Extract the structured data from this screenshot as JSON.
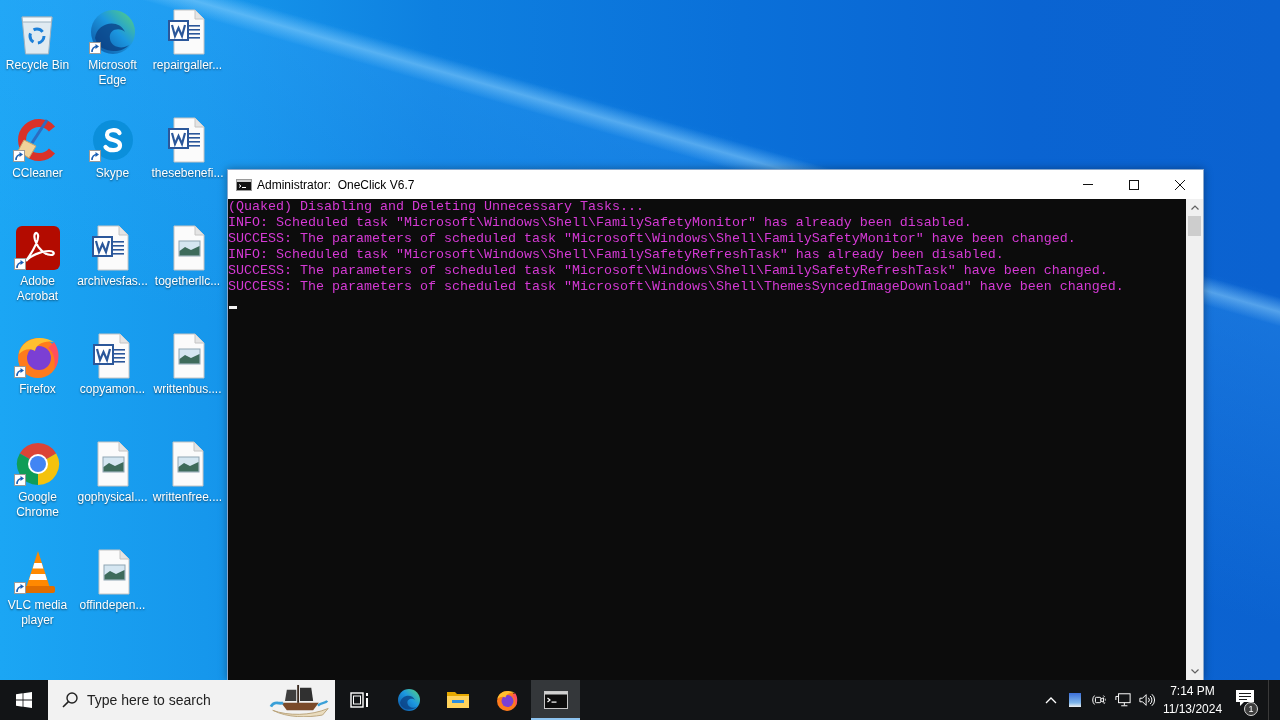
{
  "desktop": {
    "icons": [
      {
        "label": "Recycle Bin",
        "kind": "recycle-bin",
        "shortcut": false
      },
      {
        "label": "CCleaner",
        "kind": "ccleaner",
        "shortcut": true
      },
      {
        "label": "Adobe Acrobat",
        "kind": "acrobat",
        "shortcut": true
      },
      {
        "label": "Firefox",
        "kind": "firefox",
        "shortcut": true
      },
      {
        "label": "Google Chrome",
        "kind": "chrome",
        "shortcut": true
      },
      {
        "label": "VLC media player",
        "kind": "vlc",
        "shortcut": true
      },
      {
        "label": "Microsoft Edge",
        "kind": "edge",
        "shortcut": true
      },
      {
        "label": "Skype",
        "kind": "skype",
        "shortcut": true
      },
      {
        "label": "archivesfas...",
        "kind": "document",
        "shortcut": false
      },
      {
        "label": "copyamon...",
        "kind": "document",
        "shortcut": false
      },
      {
        "label": "gophysical....",
        "kind": "image",
        "shortcut": false
      },
      {
        "label": "offindepen...",
        "kind": "image",
        "shortcut": false
      },
      {
        "label": "repairgaller...",
        "kind": "document",
        "shortcut": false
      },
      {
        "label": "thesebenefi...",
        "kind": "document",
        "shortcut": false
      },
      {
        "label": "togetherllc...",
        "kind": "image",
        "shortcut": false
      },
      {
        "label": "writtenbus....",
        "kind": "image",
        "shortcut": false
      },
      {
        "label": "writtenfree....",
        "kind": "image",
        "shortcut": false
      }
    ]
  },
  "window": {
    "title": "Administrator:  OneClick V6.7",
    "lines": [
      "(Quaked) Disabling and Deleting Unnecessary Tasks...",
      "INFO: Scheduled task \"Microsoft\\Windows\\Shell\\FamilySafetyMonitor\" has already been disabled.",
      "SUCCESS: The parameters of scheduled task \"Microsoft\\Windows\\Shell\\FamilySafetyMonitor\" have been changed.",
      "INFO: Scheduled task \"Microsoft\\Windows\\Shell\\FamilySafetyRefreshTask\" has already been disabled.",
      "SUCCESS: The parameters of scheduled task \"Microsoft\\Windows\\Shell\\FamilySafetyRefreshTask\" have been changed.",
      "SUCCESS: The parameters of scheduled task \"Microsoft\\Windows\\Shell\\ThemesSyncedImageDownload\" have been changed."
    ]
  },
  "taskbar": {
    "search": {
      "placeholder": "Type here to search"
    },
    "apps": [
      {
        "kind": "task-view",
        "selected": false
      },
      {
        "kind": "edge",
        "selected": false
      },
      {
        "kind": "folder",
        "selected": false
      },
      {
        "kind": "firefox",
        "selected": false
      },
      {
        "kind": "console",
        "selected": true
      }
    ],
    "clock": {
      "time": "7:14 PM",
      "date": "11/13/2024"
    },
    "notifications": {
      "count": "1"
    }
  }
}
